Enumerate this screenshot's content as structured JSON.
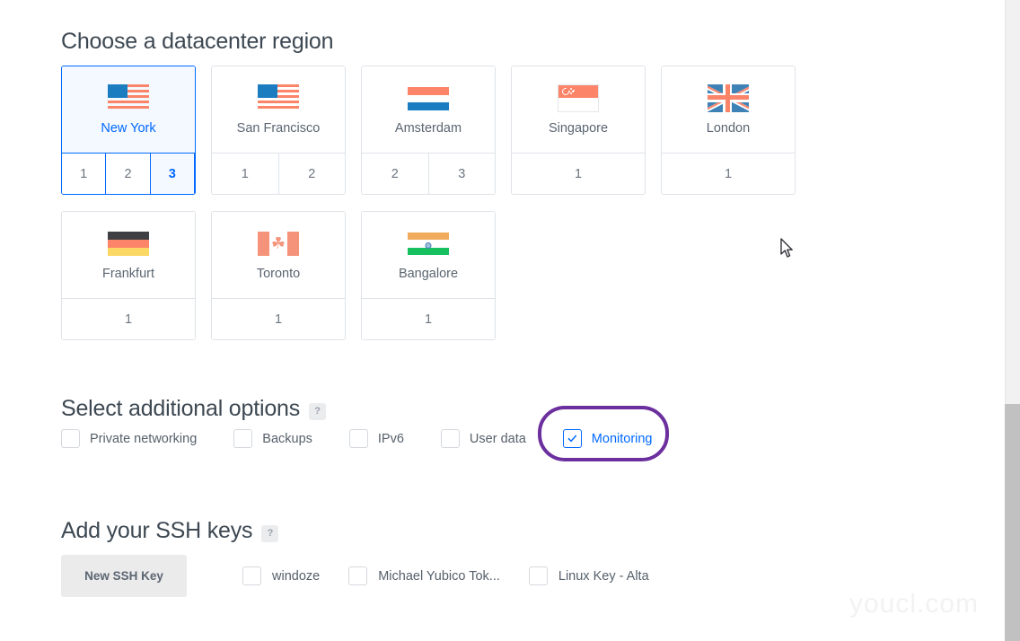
{
  "regions_section": {
    "heading": "Choose a datacenter region",
    "cards": [
      {
        "name": "New York",
        "flag": "flag-us",
        "datacenters": [
          "1",
          "2",
          "3"
        ],
        "selected": true,
        "active_datacenter": "3"
      },
      {
        "name": "San Francisco",
        "flag": "flag-us",
        "datacenters": [
          "1",
          "2"
        ],
        "selected": false,
        "active_datacenter": null
      },
      {
        "name": "Amsterdam",
        "flag": "flag-nl",
        "datacenters": [
          "2",
          "3"
        ],
        "selected": false,
        "active_datacenter": null
      },
      {
        "name": "Singapore",
        "flag": "flag-sg",
        "datacenters": [
          "1"
        ],
        "selected": false,
        "active_datacenter": null
      },
      {
        "name": "London",
        "flag": "flag-uk",
        "datacenters": [
          "1"
        ],
        "selected": false,
        "active_datacenter": null
      },
      {
        "name": "Frankfurt",
        "flag": "flag-de",
        "datacenters": [
          "1"
        ],
        "selected": false,
        "active_datacenter": null
      },
      {
        "name": "Toronto",
        "flag": "flag-ca",
        "datacenters": [
          "1"
        ],
        "selected": false,
        "active_datacenter": null
      },
      {
        "name": "Bangalore",
        "flag": "flag-in",
        "datacenters": [
          "1"
        ],
        "selected": false,
        "active_datacenter": null
      }
    ]
  },
  "options_section": {
    "heading": "Select additional options",
    "help_badge": "?",
    "options": [
      {
        "label": "Private networking",
        "checked": false
      },
      {
        "label": "Backups",
        "checked": false
      },
      {
        "label": "IPv6",
        "checked": false
      },
      {
        "label": "User data",
        "checked": false
      },
      {
        "label": "Monitoring",
        "checked": true
      }
    ]
  },
  "ssh_section": {
    "heading": "Add your SSH keys",
    "help_badge": "?",
    "new_key_button": "New SSH Key",
    "keys": [
      {
        "label": "windoze",
        "checked": false
      },
      {
        "label": "Michael Yubico Tok...",
        "checked": false
      },
      {
        "label": "Linux Key - Alta",
        "checked": false
      }
    ]
  },
  "watermark": "youcl.com",
  "colors": {
    "accent_blue": "#0069ff",
    "selected_bg": "#f4f8ff",
    "heading_text": "#3d4852",
    "body_text": "#56606b",
    "border": "#dfe3e8",
    "annotation_purple": "#6b2f9e",
    "button_bg": "#ebebeb",
    "scrollbar_thumb": "#c1c1c1"
  }
}
